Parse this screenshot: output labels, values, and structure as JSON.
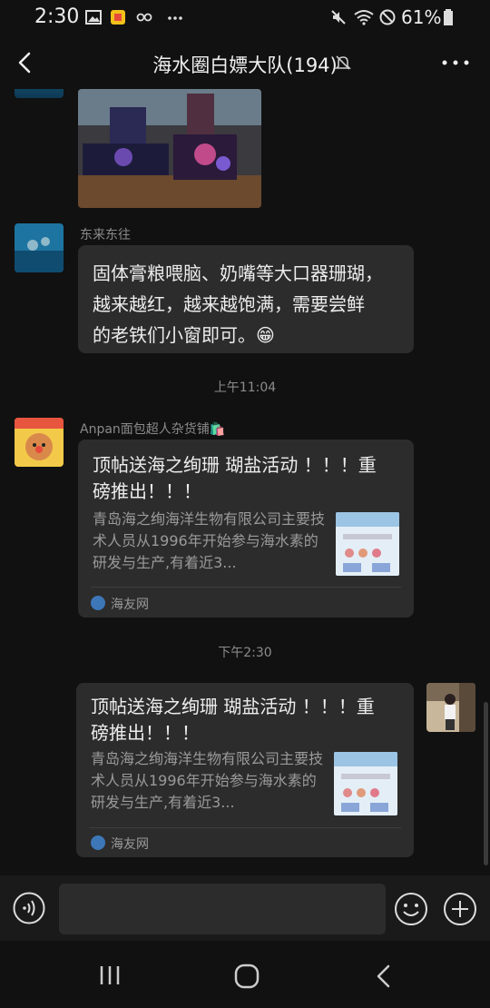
{
  "status_bar": {
    "time": "2:30",
    "battery": "61%"
  },
  "header": {
    "title": "海水圈白嫖大队(194)"
  },
  "messages": {
    "m1": {
      "sender": "东来东往",
      "lines": [
        "固体膏粮喂脑、奶嘴等大口器珊瑚，",
        "越来越红，越来越饱满，需要尝鲜",
        "的老铁们小窗即可。"
      ],
      "emoji": "😁"
    },
    "ts1": "上午11:04",
    "m2": {
      "sender": "Anpan面包超人杂货铺🛍️",
      "card_title": "顶帖送海之绚珊 瑚盐活动 ！！！重磅推出！！！",
      "card_desc": "青岛海之绚海洋生物有限公司主要技术人员从1996年开始参与海水素的研发与生产,有着近3...",
      "card_source": "海友网"
    },
    "ts2": "下午2:30",
    "m3": {
      "card_title": "顶帖送海之绚珊 瑚盐活动 ！！！重磅推出！！！",
      "card_desc": "青岛海之绚海洋生物有限公司主要技术人员从1996年开始参与海水素的研发与生产,有着近3...",
      "card_source": "海友网"
    }
  }
}
